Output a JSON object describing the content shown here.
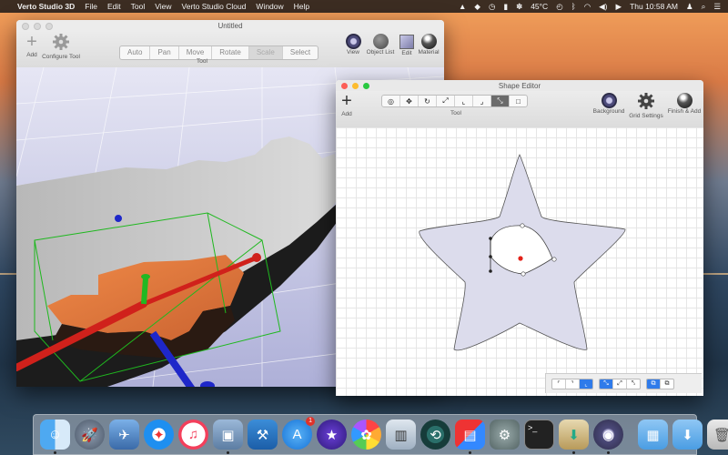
{
  "menubar": {
    "app_name": "Verto Studio 3D",
    "menus": [
      "File",
      "Edit",
      "Tool",
      "View",
      "Verto Studio Cloud",
      "Window",
      "Help"
    ],
    "temperature": "45°C",
    "clock": "Thu 10:58 AM"
  },
  "main_window": {
    "title": "Untitled",
    "add_label": "Add",
    "configure_label": "Configure Tool",
    "tool_modes": [
      "Auto",
      "Pan",
      "Move",
      "Rotate",
      "Scale",
      "Select"
    ],
    "active_mode": "Scale",
    "tool_group_label": "Tool",
    "right_tools": [
      "View",
      "Object List",
      "Edit",
      "Material"
    ]
  },
  "shape_editor": {
    "title": "Shape Editor",
    "add_label": "Add",
    "tool_group_label": "Tool",
    "tool_icons": [
      "select-icon",
      "move-icon",
      "rotate-icon",
      "scale-icon",
      "add-point-icon",
      "add-curve-point-icon",
      "curve-icon",
      "rect-icon"
    ],
    "active_tool_index": 6,
    "right_tools": [
      "Background",
      "Grid Settings",
      "Finish & Add"
    ]
  },
  "dock": {
    "badge_count": "1",
    "apps": [
      "Finder",
      "Launchpad",
      "Preview",
      "Safari",
      "iTunes",
      "Photo Browser",
      "Xcode",
      "App Store",
      "iMovie",
      "Photos",
      "Preview Viewer",
      "Time Machine",
      "Parallels",
      "System Preferences",
      "Terminal",
      "Installer",
      "Verto Studio 3D",
      "Applications",
      "Downloads",
      "Trash"
    ]
  },
  "colors": {
    "accent": "#2f7bea",
    "selection": "#1fb81f",
    "orange": "#e2793d"
  }
}
